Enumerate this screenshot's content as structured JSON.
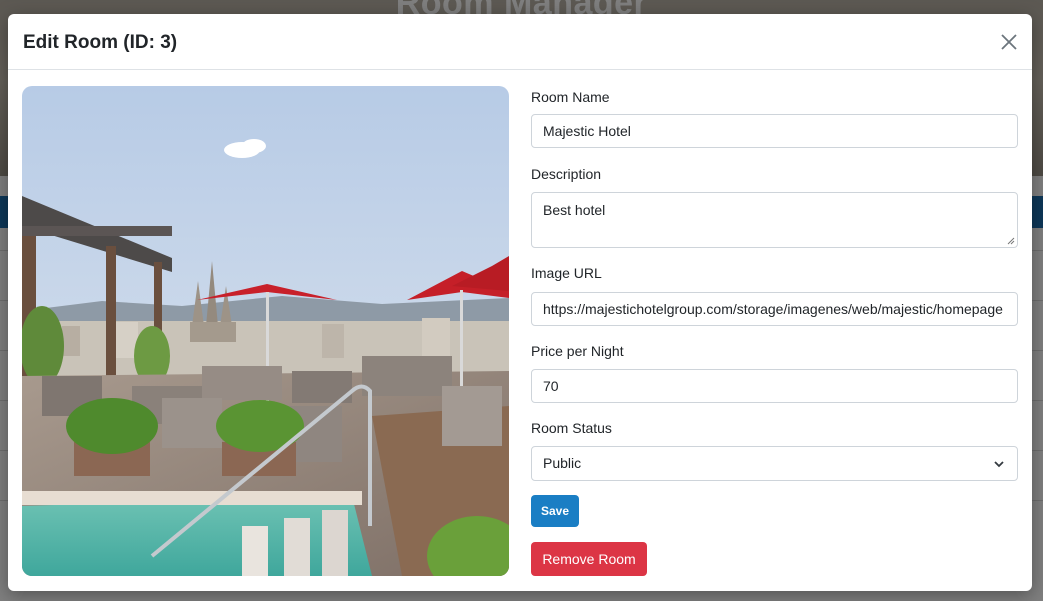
{
  "background_page": {
    "title": "Room Manager"
  },
  "modal": {
    "title": "Edit Room (ID: 3)",
    "close_icon": "close-icon",
    "image_alt": "room-photo"
  },
  "form": {
    "room_name": {
      "label": "Room Name",
      "value": "Majestic Hotel"
    },
    "description": {
      "label": "Description",
      "value": "Best hotel"
    },
    "image_url": {
      "label": "Image URL",
      "value": "https://majestichotelgroup.com/storage/imagenes/web/majestic/homepage"
    },
    "price": {
      "label": "Price per Night",
      "value": "70"
    },
    "status": {
      "label": "Room Status",
      "selected": "Public",
      "icon": "chevron-down-icon"
    },
    "save_label": "Save",
    "remove_label": "Remove Room"
  },
  "colors": {
    "save_button": "#1a7ec4",
    "remove_button": "#dc3545",
    "header_bar": "#1b6fb0"
  }
}
